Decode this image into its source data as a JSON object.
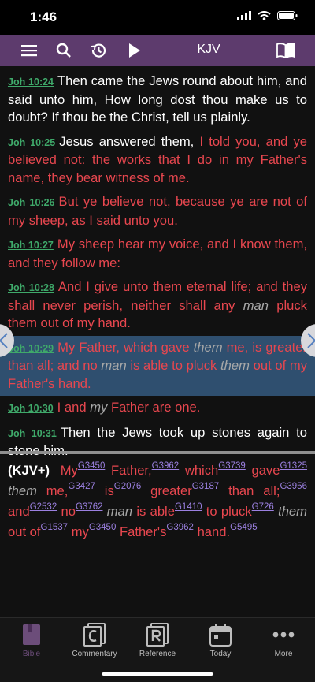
{
  "status": {
    "time": "1:46"
  },
  "toolbar": {
    "title": "KJV"
  },
  "verses": [
    {
      "ref": "Joh 10:24",
      "segments": [
        {
          "t": "Then came the Jews round about him, and said unto him, How long dost thou make us to doubt? If thou be the Christ, tell us plainly.",
          "s": "w"
        }
      ]
    },
    {
      "ref": "Joh 10:25",
      "segments": [
        {
          "t": "Jesus answered them, ",
          "s": "w"
        },
        {
          "t": "I told you, and ye believed not: the works that I do in my Father's name, they bear witness of me.",
          "s": "r"
        }
      ]
    },
    {
      "ref": "Joh 10:26",
      "segments": [
        {
          "t": "But ye believe not, because ye are not of my sheep, as I said unto you.",
          "s": "r"
        }
      ]
    },
    {
      "ref": "Joh 10:27",
      "segments": [
        {
          "t": "My sheep hear my voice, and I know them, and they follow me:",
          "s": "r"
        }
      ]
    },
    {
      "ref": "Joh 10:28",
      "segments": [
        {
          "t": "And I give unto them eternal life; and they shall never perish, neither shall any ",
          "s": "r"
        },
        {
          "t": "man",
          "s": "i"
        },
        {
          "t": " pluck them out of my hand.",
          "s": "r"
        }
      ]
    },
    {
      "ref": "Joh 10:29",
      "selected": true,
      "segments": [
        {
          "t": "My Father, which gave ",
          "s": "r"
        },
        {
          "t": "them",
          "s": "i"
        },
        {
          "t": " me, is greater than all; and no ",
          "s": "r"
        },
        {
          "t": "man",
          "s": "i"
        },
        {
          "t": " is able to pluck ",
          "s": "r"
        },
        {
          "t": "them",
          "s": "i"
        },
        {
          "t": " out of my Father's hand.",
          "s": "r"
        }
      ]
    },
    {
      "ref": "Joh 10:30",
      "segments": [
        {
          "t": "I and ",
          "s": "r"
        },
        {
          "t": "my",
          "s": "i"
        },
        {
          "t": " Father are one.",
          "s": "r"
        }
      ]
    },
    {
      "ref": "Joh 10:31",
      "segments": [
        {
          "t": "Then the Jews took up stones again to stone him.",
          "s": "w"
        }
      ]
    }
  ],
  "strongs": {
    "label": "(KJV+)",
    "words": [
      {
        "t": "My",
        "s": "r",
        "code": "G3450"
      },
      {
        "t": "Father,",
        "s": "r",
        "code": "G3962"
      },
      {
        "t": "which",
        "s": "r",
        "code": "G3739"
      },
      {
        "t": "gave",
        "s": "r",
        "code": "G1325"
      },
      {
        "t": "them",
        "s": "i",
        "code": ""
      },
      {
        "t": "me,",
        "s": "r",
        "code": "G3427"
      },
      {
        "t": "is",
        "s": "r",
        "code": "G2076"
      },
      {
        "t": "greater",
        "s": "r",
        "code": "G3187"
      },
      {
        "t": "than all;",
        "s": "r",
        "code": "G3956"
      },
      {
        "t": "and",
        "s": "r",
        "code": "G2532"
      },
      {
        "t": "no",
        "s": "r",
        "code": "G3762"
      },
      {
        "t": "man",
        "s": "i",
        "code": ""
      },
      {
        "t": "is able",
        "s": "r",
        "code": "G1410"
      },
      {
        "t": "to pluck",
        "s": "r",
        "code": "G726"
      },
      {
        "t": "them",
        "s": "i",
        "code": ""
      },
      {
        "t": "out of",
        "s": "r",
        "code": "G1537"
      },
      {
        "t": "my",
        "s": "r",
        "code": "G3450"
      },
      {
        "t": "Father's",
        "s": "r",
        "code": "G3962"
      },
      {
        "t": "hand.",
        "s": "r",
        "code": "G5495"
      }
    ]
  },
  "tabs": [
    {
      "label": "Bible",
      "icon": "bible-icon",
      "active": true
    },
    {
      "label": "Commentary",
      "icon": "commentary-icon",
      "active": false
    },
    {
      "label": "Reference",
      "icon": "reference-icon",
      "active": false
    },
    {
      "label": "Today",
      "icon": "calendar-icon",
      "active": false
    },
    {
      "label": "More",
      "icon": "more-icon",
      "active": false
    }
  ],
  "colors": {
    "toolbar": "#5d3b6d",
    "red_letter": "#e8474f",
    "ref_link": "#3fa96a",
    "strongs_link": "#9b80e0",
    "selection": "#2f4f6f"
  }
}
